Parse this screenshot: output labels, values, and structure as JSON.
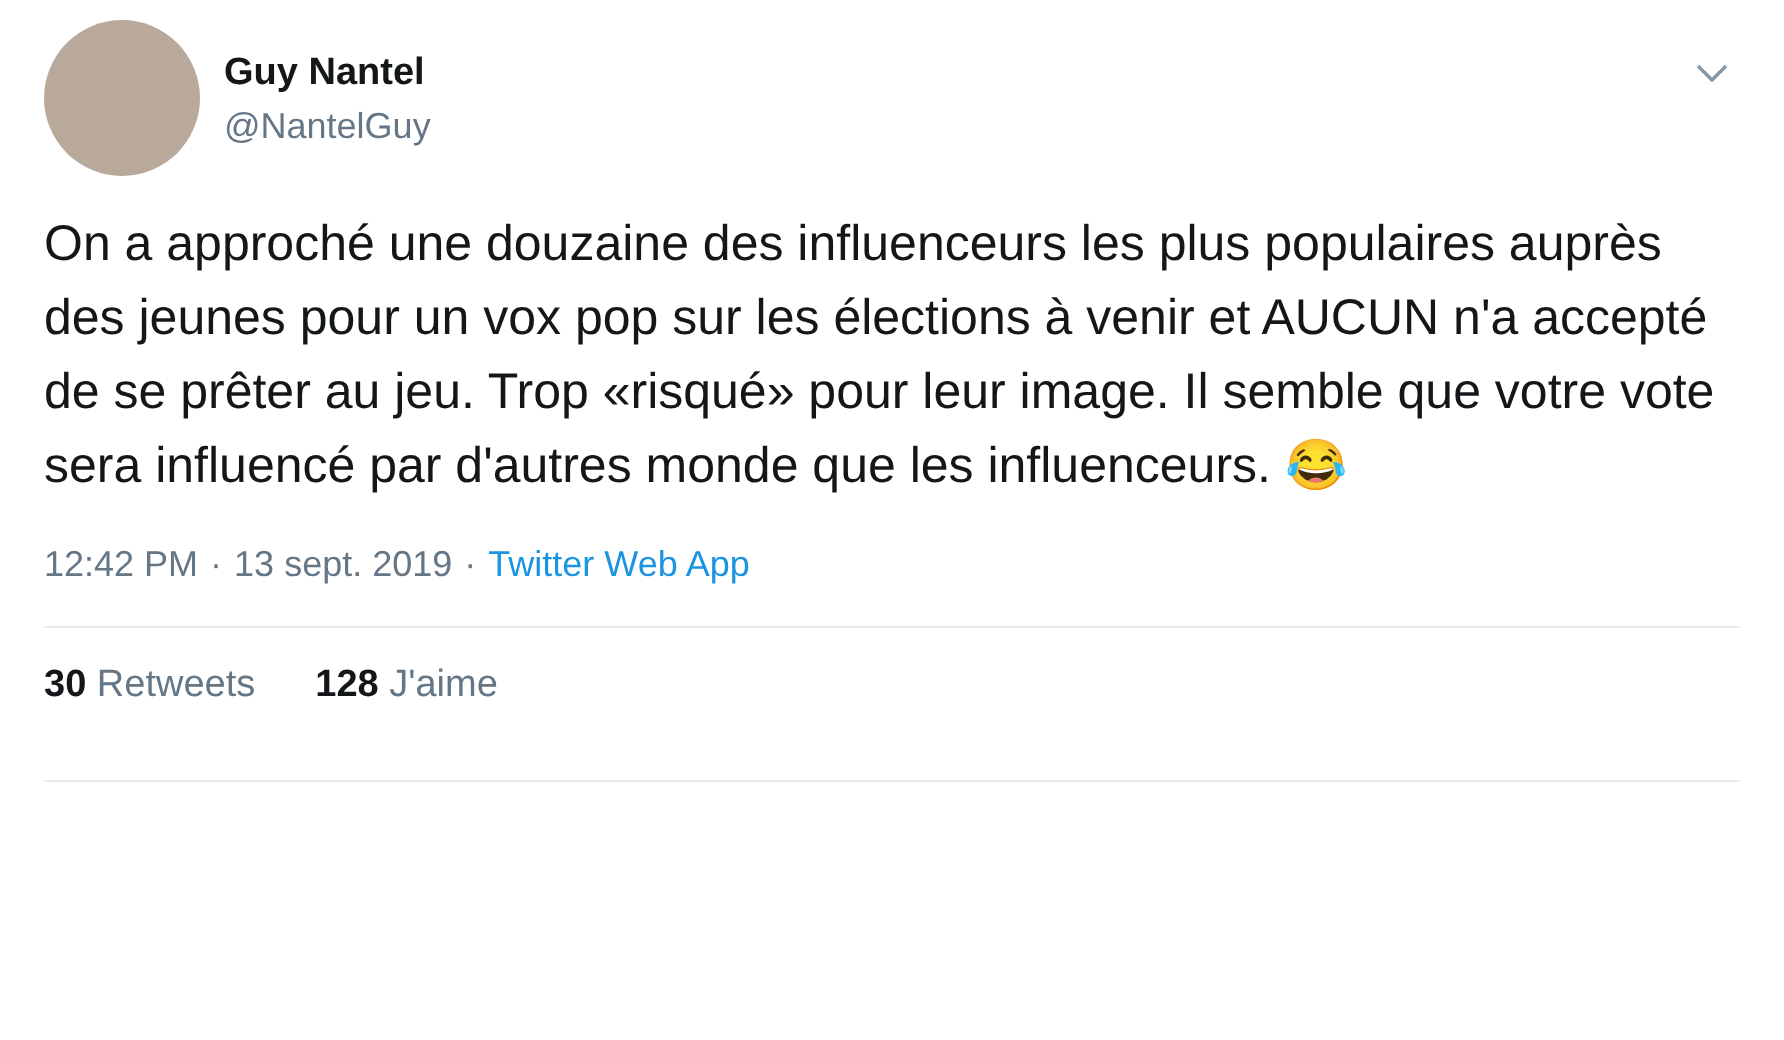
{
  "author": {
    "name": "Guy Nantel",
    "handle": "@NantelGuy"
  },
  "body": "On a approché une douzaine des influenceurs les plus populaires auprès des jeunes pour un vox pop sur les élections à venir et AUCUN n'a accepté de se prêter au jeu. Trop «risqué» pour leur image. Il semble que votre vote sera influencé par d'autres monde que les influenceurs. 😂",
  "meta": {
    "time": "12:42 PM",
    "separator_1": "·",
    "date": "13 sept. 2019",
    "separator_2": "·",
    "source": "Twitter Web App"
  },
  "stats": [
    {
      "count": "30",
      "label": "Retweets"
    },
    {
      "count": "128",
      "label": "J'aime"
    }
  ]
}
